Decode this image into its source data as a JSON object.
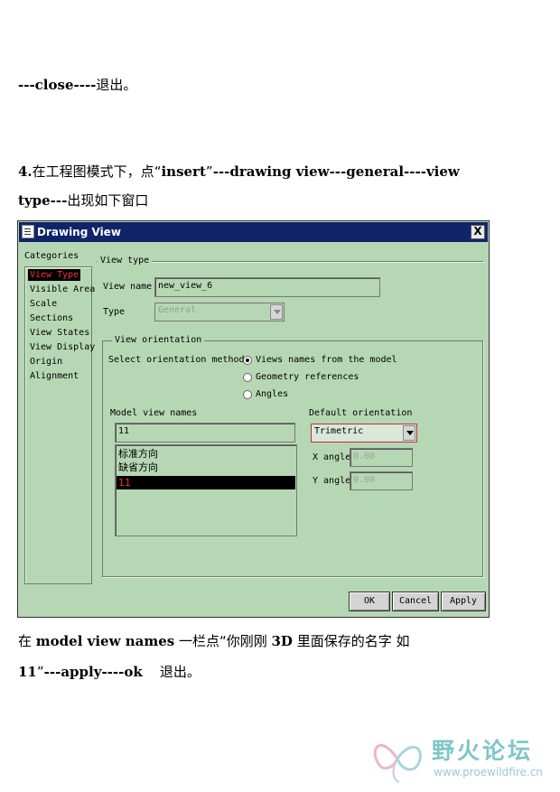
{
  "document": {
    "line1": {
      "bold": "---close----",
      "cn": "退出。"
    },
    "step4_line1": {
      "p1": "4.",
      "p2": "在工程图模式下，点",
      "p3": "“",
      "p4": "insert",
      "p5": "”",
      "p6": "---drawing view---general----view"
    },
    "step4_line2": {
      "p1": "type---",
      "p2": "出现如下窗口"
    },
    "after_line1": {
      "p1": "在 ",
      "p2": "model  view  names",
      "p3": " 一栏点“你刚刚 ",
      "p4": "3D",
      "p5": " 里面保存的名字  如"
    },
    "after_line2": {
      "p1": "11",
      "p2": "”",
      "p3": "---apply----ok",
      "p4": "    退出。"
    }
  },
  "dialog": {
    "title": "Drawing View",
    "close_glyph": "X",
    "categories_label": "Categories",
    "categories": [
      "View Type",
      "Visible Area",
      "Scale",
      "Sections",
      "View States",
      "View Display",
      "Origin",
      "Alignment"
    ],
    "selected_category": "View Type",
    "view_type_group": "View type",
    "view_name_label": "View name",
    "view_name_value": "new_view_6",
    "type_label": "Type",
    "type_value": "General",
    "orientation_group": "View orientation",
    "select_method_label": "Select orientation method",
    "methods": [
      "Views names from the model",
      "Geometry references",
      "Angles"
    ],
    "selected_method": "Views names from the model",
    "model_view_names_label": "Model view names",
    "model_view_input": "11",
    "model_views": [
      "标准方向",
      "缺省方向",
      "11"
    ],
    "selected_model_view": "11",
    "default_orientation_label": "Default orientation",
    "default_orientation_value": "Trimetric",
    "x_angle_label": "X angle",
    "x_angle_value": "0.00",
    "y_angle_label": "Y angle",
    "y_angle_value": "0.00",
    "buttons": {
      "ok": "OK",
      "cancel": "Cancel",
      "apply": "Apply"
    },
    "colors": {
      "background": "#b6d7b4",
      "titlebar": "#10246a",
      "selection_text": "#ff3030"
    }
  },
  "watermark": {
    "title": "野火论坛",
    "url": "www.proewildfire.cn"
  }
}
